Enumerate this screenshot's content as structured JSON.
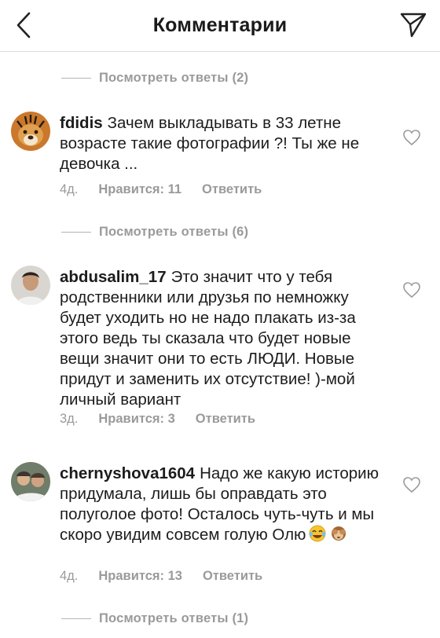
{
  "header": {
    "title": "Комментарии"
  },
  "replies_labels": [
    "Посмотреть ответы (2)",
    "Посмотреть ответы (6)",
    "Посмотреть ответы (1)"
  ],
  "comments": [
    {
      "username": "fdidis",
      "text": "Зачем выкладывать в 33 летне возрасте такие фотографии ?! Ты же не девочка ...",
      "time": "4д.",
      "likes": "Нравится: 11",
      "reply": "Ответить"
    },
    {
      "username": "abdusalim_17",
      "text": "Это значит что у тебя родственники или друзья по немножку будет уходить но не надо плакать из-за этого ведь ты сказала что будет новые вещи значит они то есть ЛЮДИ. Новые придут и заменить их отсутствие! )-мой личный вариант",
      "time": "3д.",
      "likes": "Нравится: 3",
      "reply": "Ответить"
    },
    {
      "username": "chernyshova1604",
      "text": "Надо же какую историю придумала, лишь бы оправдать это полуголое фото! Осталось чуть-чуть и мы скоро увидим совсем голую Олю",
      "emojis": [
        "face-with-tears-of-joy-emoji",
        "see-no-evil-monkey-emoji"
      ],
      "time": "4д.",
      "likes": "Нравится: 13",
      "reply": "Ответить"
    }
  ],
  "colors": {
    "secondary_text": "#9a9a9a",
    "divider": "#dcdcdc",
    "primary_text": "#1c1c1c"
  }
}
